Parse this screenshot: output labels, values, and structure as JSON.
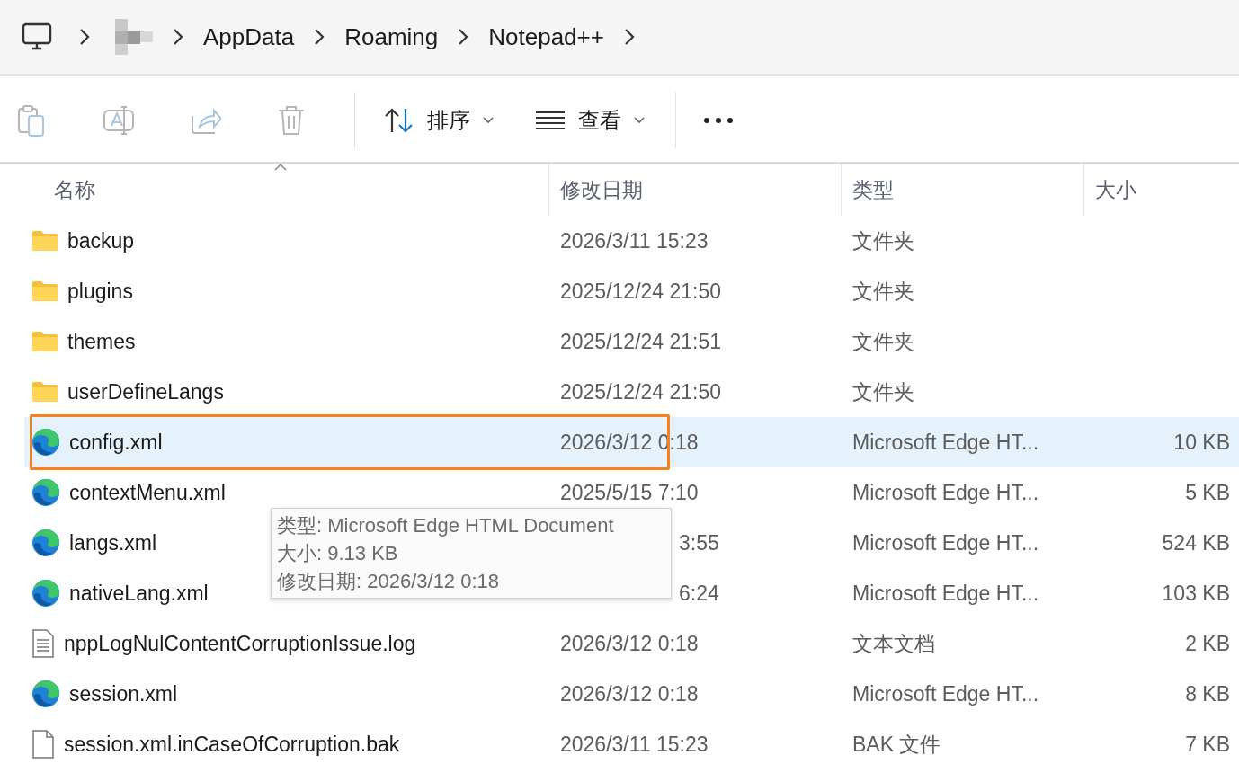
{
  "breadcrumb": {
    "items": [
      "AppData",
      "Roaming",
      "Notepad++"
    ]
  },
  "toolbar": {
    "actions": [
      {
        "kind": "paste",
        "disabled": true
      },
      {
        "kind": "rename",
        "disabled": true
      },
      {
        "kind": "share",
        "disabled": true
      },
      {
        "kind": "delete",
        "disabled": true
      }
    ],
    "menus": [
      {
        "kind": "sort",
        "label": "排序"
      },
      {
        "kind": "view",
        "label": "查看"
      }
    ]
  },
  "table": {
    "columns": [
      {
        "label": "名称",
        "sorted": true
      },
      {
        "label": "修改日期",
        "sorted": false
      },
      {
        "label": "类型",
        "sorted": false
      },
      {
        "label": "大小",
        "sorted": false
      }
    ],
    "rows": [
      {
        "kind": "folder",
        "name": "backup",
        "date": "2026/3/11 15:23",
        "type": "文件夹",
        "selected": false,
        "highlighted": false,
        "date_under_tooltip": false
      },
      {
        "kind": "folder",
        "name": "plugins",
        "date": "2025/12/24 21:50",
        "type": "文件夹",
        "selected": false,
        "highlighted": false,
        "date_under_tooltip": false
      },
      {
        "kind": "folder",
        "name": "themes",
        "date": "2025/12/24 21:51",
        "type": "文件夹",
        "selected": false,
        "highlighted": false,
        "date_under_tooltip": false
      },
      {
        "kind": "folder",
        "name": "userDefineLangs",
        "date": "2025/12/24 21:50",
        "type": "文件夹",
        "selected": false,
        "highlighted": false,
        "date_under_tooltip": false
      },
      {
        "kind": "edge",
        "name": "config.xml",
        "date": "2026/3/12 0:18",
        "type": "Microsoft Edge HT...",
        "size": "10 KB",
        "selected": true,
        "highlighted": true,
        "date_under_tooltip": false
      },
      {
        "kind": "edge",
        "name": "contextMenu.xml",
        "date": "2025/5/15 7:10",
        "type": "Microsoft Edge HT...",
        "size": "5 KB",
        "selected": false,
        "highlighted": false,
        "date_under_tooltip": false
      },
      {
        "kind": "edge",
        "name": "langs.xml",
        "date": "3:55",
        "date_under_tooltip": true,
        "type": "Microsoft Edge HT...",
        "size": "524 KB",
        "selected": false,
        "highlighted": false
      },
      {
        "kind": "edge",
        "name": "nativeLang.xml",
        "date": "6:24",
        "date_under_tooltip": true,
        "type": "Microsoft Edge HT...",
        "size": "103 KB",
        "selected": false,
        "highlighted": false
      },
      {
        "kind": "text",
        "name": "nppLogNulContentCorruptionIssue.log",
        "date": "2026/3/12 0:18",
        "type": "文本文档",
        "size": "2 KB",
        "selected": false,
        "highlighted": false,
        "date_under_tooltip": false
      },
      {
        "kind": "edge",
        "name": "session.xml",
        "date": "2026/3/12 0:18",
        "type": "Microsoft Edge HT...",
        "size": "8 KB",
        "selected": false,
        "highlighted": false,
        "date_under_tooltip": false
      },
      {
        "kind": "file",
        "name": "session.xml.inCaseOfCorruption.bak",
        "date": "2026/3/11 15:23",
        "type": "BAK 文件",
        "size": "7 KB",
        "selected": false,
        "highlighted": false,
        "date_under_tooltip": false
      }
    ]
  },
  "tooltip": {
    "lines": [
      "类型: Microsoft Edge HTML Document",
      "大小: 9.13 KB",
      "修改日期: 2026/3/12 0:18"
    ]
  }
}
